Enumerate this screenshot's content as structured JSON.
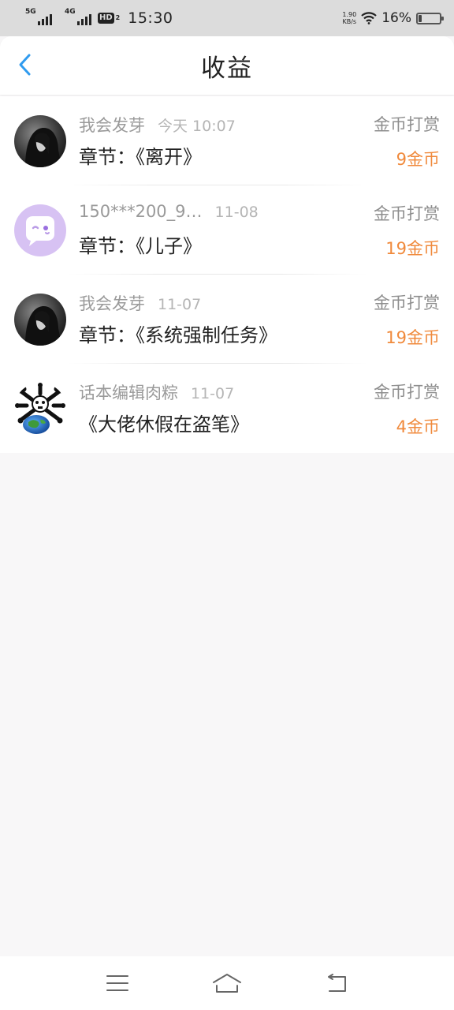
{
  "status_bar": {
    "signal1_label": "5G",
    "signal2_label": "4G",
    "hd_label": "HD",
    "hd_sub": "2",
    "time": "15:30",
    "speed_value": "1.90",
    "speed_unit": "KB/s",
    "battery_percent_label": "16%",
    "battery_level": 0.16
  },
  "header": {
    "back_icon": "chevron-left-icon",
    "title": "收益",
    "accent": "#2f9bef"
  },
  "records": [
    {
      "user": "我会发芽",
      "time": "今天  10:07",
      "chapter": "章节：《离开》",
      "type": "金币打赏",
      "amount": "9金币",
      "avatar": "dark-hooded-figure"
    },
    {
      "user": "150***200_9…",
      "time": "11-08",
      "chapter": "章节：《儿子》",
      "type": "金币打赏",
      "amount": "19金币",
      "avatar": "purple-chat-bubble"
    },
    {
      "user": "我会发芽",
      "time": "11-07",
      "chapter": "章节：《系统强制任务》",
      "type": "金币打赏",
      "amount": "19金币",
      "avatar": "dark-hooded-figure"
    },
    {
      "user": "话本编辑肉粽",
      "time": "11-07",
      "chapter": "《大佬休假在盗笔》",
      "type": "金币打赏",
      "amount": "4金币",
      "avatar": "skull-crossbones-globe"
    }
  ],
  "colors": {
    "amount": "#f08a3c",
    "secondary_text": "#9a9a9a",
    "primary_text": "#222222"
  },
  "nav_bar": {
    "menu_icon": "menu-icon",
    "home_icon": "home-icon",
    "back_icon": "back-arrow-icon"
  }
}
